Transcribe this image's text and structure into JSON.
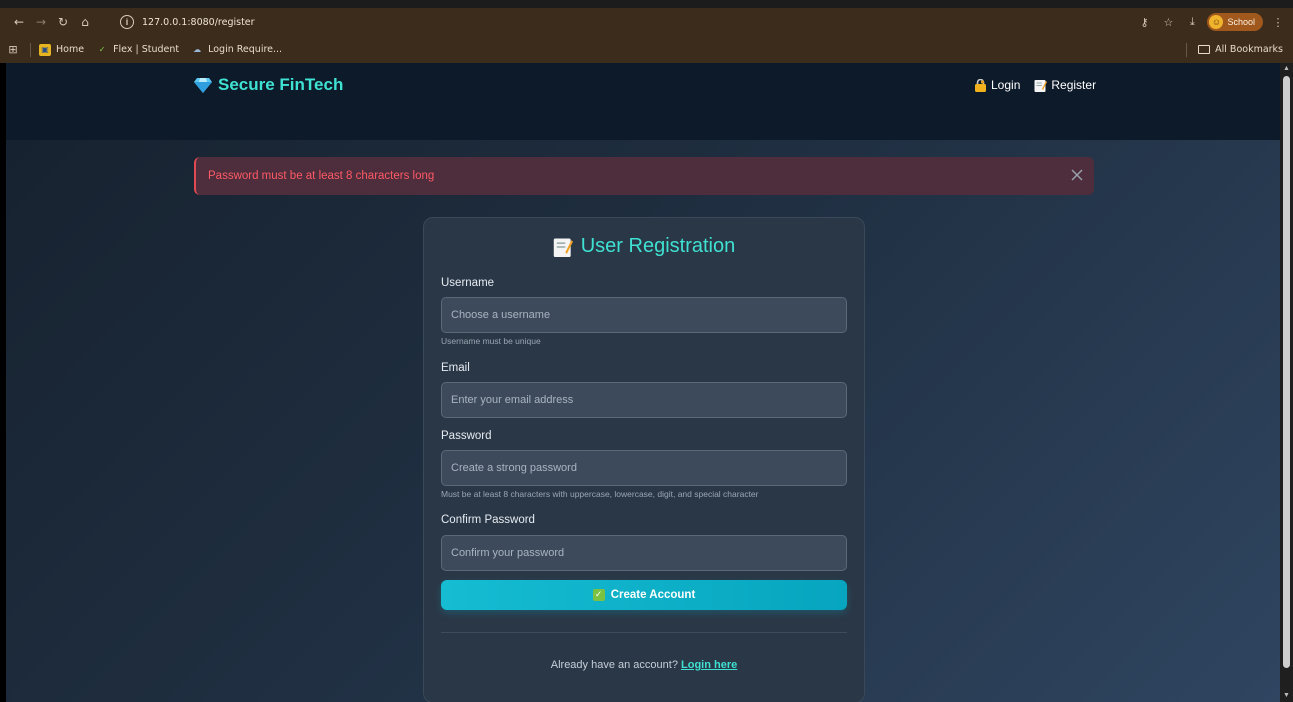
{
  "browser": {
    "url": "127.0.0.1:8080/register",
    "profile_label": "School",
    "bookmarks": [
      {
        "label": "Home"
      },
      {
        "label": "Flex | Student"
      },
      {
        "label": "Login Require..."
      }
    ],
    "all_bookmarks_label": "All Bookmarks"
  },
  "navbar": {
    "brand": "Secure FinTech",
    "login_label": "Login",
    "register_label": "Register"
  },
  "alert": {
    "message": "Password must be at least 8 characters long"
  },
  "form": {
    "title": "User Registration",
    "username": {
      "label": "Username",
      "placeholder": "Choose a username",
      "value": "",
      "hint": "Username must be unique"
    },
    "email": {
      "label": "Email",
      "placeholder": "Enter your email address",
      "value": ""
    },
    "password": {
      "label": "Password",
      "placeholder": "Create a strong password",
      "value": "",
      "hint": "Must be at least 8 characters with uppercase, lowercase, digit, and special character"
    },
    "confirm_password": {
      "label": "Confirm Password",
      "placeholder": "Confirm your password",
      "value": ""
    },
    "submit_label": "Create Account",
    "footer_text": "Already have an account?",
    "footer_link": "Login here"
  },
  "colors": {
    "accent": "#3fe1d2",
    "button": "#15bcd2",
    "error": "#ff5a66",
    "navbar": "#0c1a2a"
  },
  "icons": [
    "back-icon",
    "forward-icon",
    "reload-icon",
    "home-icon",
    "site-info-icon",
    "key-icon",
    "star-icon",
    "download-icon",
    "menu-icon",
    "apps-icon",
    "gem-icon",
    "lock-icon",
    "memo-icon",
    "close-icon",
    "check-icon",
    "folder-icon"
  ]
}
